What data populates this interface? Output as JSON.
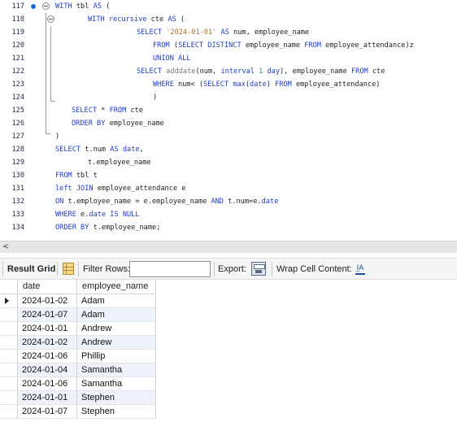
{
  "editor": {
    "lines": [
      {
        "num": "117",
        "tokens": [
          {
            "t": "WITH",
            "c": "kw"
          },
          {
            "t": " tbl "
          },
          {
            "t": "AS",
            "c": "kw"
          },
          {
            "t": " ("
          }
        ]
      },
      {
        "num": "118",
        "tokens": [
          {
            "t": "WITH recursive",
            "c": "kw"
          },
          {
            "t": " cte "
          },
          {
            "t": "AS",
            "c": "kw"
          },
          {
            "t": " ("
          }
        ]
      },
      {
        "num": "119",
        "tokens": [
          {
            "t": "SELECT",
            "c": "kw"
          },
          {
            "t": " "
          },
          {
            "t": "'2024-01-01'",
            "c": "str"
          },
          {
            "t": " "
          },
          {
            "t": "AS",
            "c": "kw"
          },
          {
            "t": " num, employee_name"
          }
        ]
      },
      {
        "num": "120",
        "tokens": [
          {
            "t": "FROM",
            "c": "kw"
          },
          {
            "t": " ("
          },
          {
            "t": "SELECT DISTINCT",
            "c": "kw"
          },
          {
            "t": " employee_name "
          },
          {
            "t": "FROM",
            "c": "kw"
          },
          {
            "t": " employee_attendance)z"
          }
        ]
      },
      {
        "num": "121",
        "tokens": [
          {
            "t": "UNION ALL",
            "c": "kw"
          }
        ]
      },
      {
        "num": "122",
        "tokens": [
          {
            "t": "SELECT",
            "c": "kw"
          },
          {
            "t": " "
          },
          {
            "t": "adddate",
            "c": "fn"
          },
          {
            "t": "(num, "
          },
          {
            "t": "interval",
            "c": "kw"
          },
          {
            "t": " "
          },
          {
            "t": "1",
            "c": "num"
          },
          {
            "t": " "
          },
          {
            "t": "day",
            "c": "kw"
          },
          {
            "t": "), employee_name "
          },
          {
            "t": "FROM",
            "c": "kw"
          },
          {
            "t": " cte"
          }
        ]
      },
      {
        "num": "123",
        "tokens": [
          {
            "t": "WHERE",
            "c": "kw"
          },
          {
            "t": " num< ("
          },
          {
            "t": "SELECT",
            "c": "kw"
          },
          {
            "t": " "
          },
          {
            "t": "max",
            "c": "kw"
          },
          {
            "t": "("
          },
          {
            "t": "date",
            "c": "kw"
          },
          {
            "t": ") "
          },
          {
            "t": "FROM",
            "c": "kw"
          },
          {
            "t": " employee_attendance)"
          }
        ]
      },
      {
        "num": "124",
        "tokens": [
          {
            "t": ")"
          }
        ]
      },
      {
        "num": "125",
        "tokens": [
          {
            "t": "SELECT",
            "c": "kw"
          },
          {
            "t": " * "
          },
          {
            "t": "FROM",
            "c": "kw"
          },
          {
            "t": " cte"
          }
        ]
      },
      {
        "num": "126",
        "tokens": [
          {
            "t": "ORDER BY",
            "c": "kw"
          },
          {
            "t": " employee_name"
          }
        ]
      },
      {
        "num": "127",
        "tokens": [
          {
            "t": ")"
          }
        ]
      },
      {
        "num": "128",
        "tokens": [
          {
            "t": "SELECT",
            "c": "kw"
          },
          {
            "t": " t.num "
          },
          {
            "t": "AS",
            "c": "kw"
          },
          {
            "t": " "
          },
          {
            "t": "date",
            "c": "kw"
          },
          {
            "t": ","
          }
        ]
      },
      {
        "num": "129",
        "tokens": [
          {
            "t": "t.employee_name"
          }
        ]
      },
      {
        "num": "130",
        "tokens": [
          {
            "t": "FROM",
            "c": "kw"
          },
          {
            "t": " tbl t"
          }
        ]
      },
      {
        "num": "131",
        "tokens": [
          {
            "t": "left JOIN",
            "c": "kw"
          },
          {
            "t": " employee_attendance e"
          }
        ]
      },
      {
        "num": "132",
        "tokens": [
          {
            "t": "ON",
            "c": "kw"
          },
          {
            "t": " t.employee_name = e.employee_name "
          },
          {
            "t": "AND",
            "c": "kw"
          },
          {
            "t": " t.num=e."
          },
          {
            "t": "date",
            "c": "kw"
          }
        ]
      },
      {
        "num": "133",
        "tokens": [
          {
            "t": "WHERE",
            "c": "kw"
          },
          {
            "t": " e."
          },
          {
            "t": "date",
            "c": "kw"
          },
          {
            "t": " "
          },
          {
            "t": "IS NULL",
            "c": "kw"
          }
        ]
      },
      {
        "num": "134",
        "tokens": [
          {
            "t": "ORDER BY",
            "c": "kw"
          },
          {
            "t": " t.employee_name;"
          }
        ]
      }
    ]
  },
  "scrollbar": {
    "left_arrow": "<"
  },
  "toolbar": {
    "result_grid_label": "Result Grid",
    "filter_rows_label": "Filter Rows:",
    "filter_value": "",
    "export_label": "Export:",
    "wrap_label": "Wrap Cell Content:",
    "wrap_icon_glyph": "I̲A"
  },
  "grid": {
    "columns": [
      "date",
      "employee_name"
    ],
    "rows": [
      [
        "2024-01-02",
        "Adam"
      ],
      [
        "2024-01-07",
        "Adam"
      ],
      [
        "2024-01-01",
        "Andrew"
      ],
      [
        "2024-01-02",
        "Andrew"
      ],
      [
        "2024-01-06",
        "Phillip"
      ],
      [
        "2024-01-04",
        "Samantha"
      ],
      [
        "2024-01-06",
        "Samantha"
      ],
      [
        "2024-01-01",
        "Stephen"
      ],
      [
        "2024-01-07",
        "Stephen"
      ]
    ],
    "selected_row": 0
  }
}
